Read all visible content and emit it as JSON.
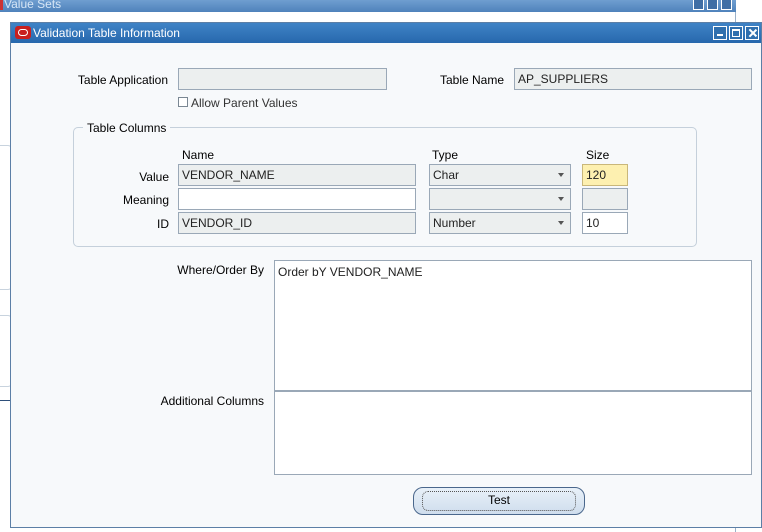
{
  "background_window": {
    "title": "Value Sets"
  },
  "dialog": {
    "title": "Validation Table Information",
    "table_application": {
      "label": "Table Application",
      "value": ""
    },
    "table_name": {
      "label": "Table Name",
      "value": "AP_SUPPLIERS"
    },
    "allow_parent_values": {
      "label": "Allow Parent Values",
      "checked": false
    },
    "table_columns": {
      "group_label": "Table Columns",
      "headers": {
        "name": "Name",
        "type": "Type",
        "size": "Size"
      },
      "rows": {
        "value": {
          "label": "Value",
          "name": "VENDOR_NAME",
          "type": "Char",
          "size": "120"
        },
        "meaning": {
          "label": "Meaning",
          "name": "",
          "type": "",
          "size": ""
        },
        "id": {
          "label": "ID",
          "name": "VENDOR_ID",
          "type": "Number",
          "size": "10"
        }
      }
    },
    "where_order_by": {
      "label": "Where/Order By",
      "value": "Order bY VENDOR_NAME"
    },
    "additional_columns": {
      "label": "Additional Columns",
      "value": ""
    },
    "test_button": {
      "label": "Test"
    }
  },
  "colors": {
    "titlebar": "#2f77bd",
    "focused_field": "#fdf0b0",
    "readonly_field": "#ecefef"
  }
}
